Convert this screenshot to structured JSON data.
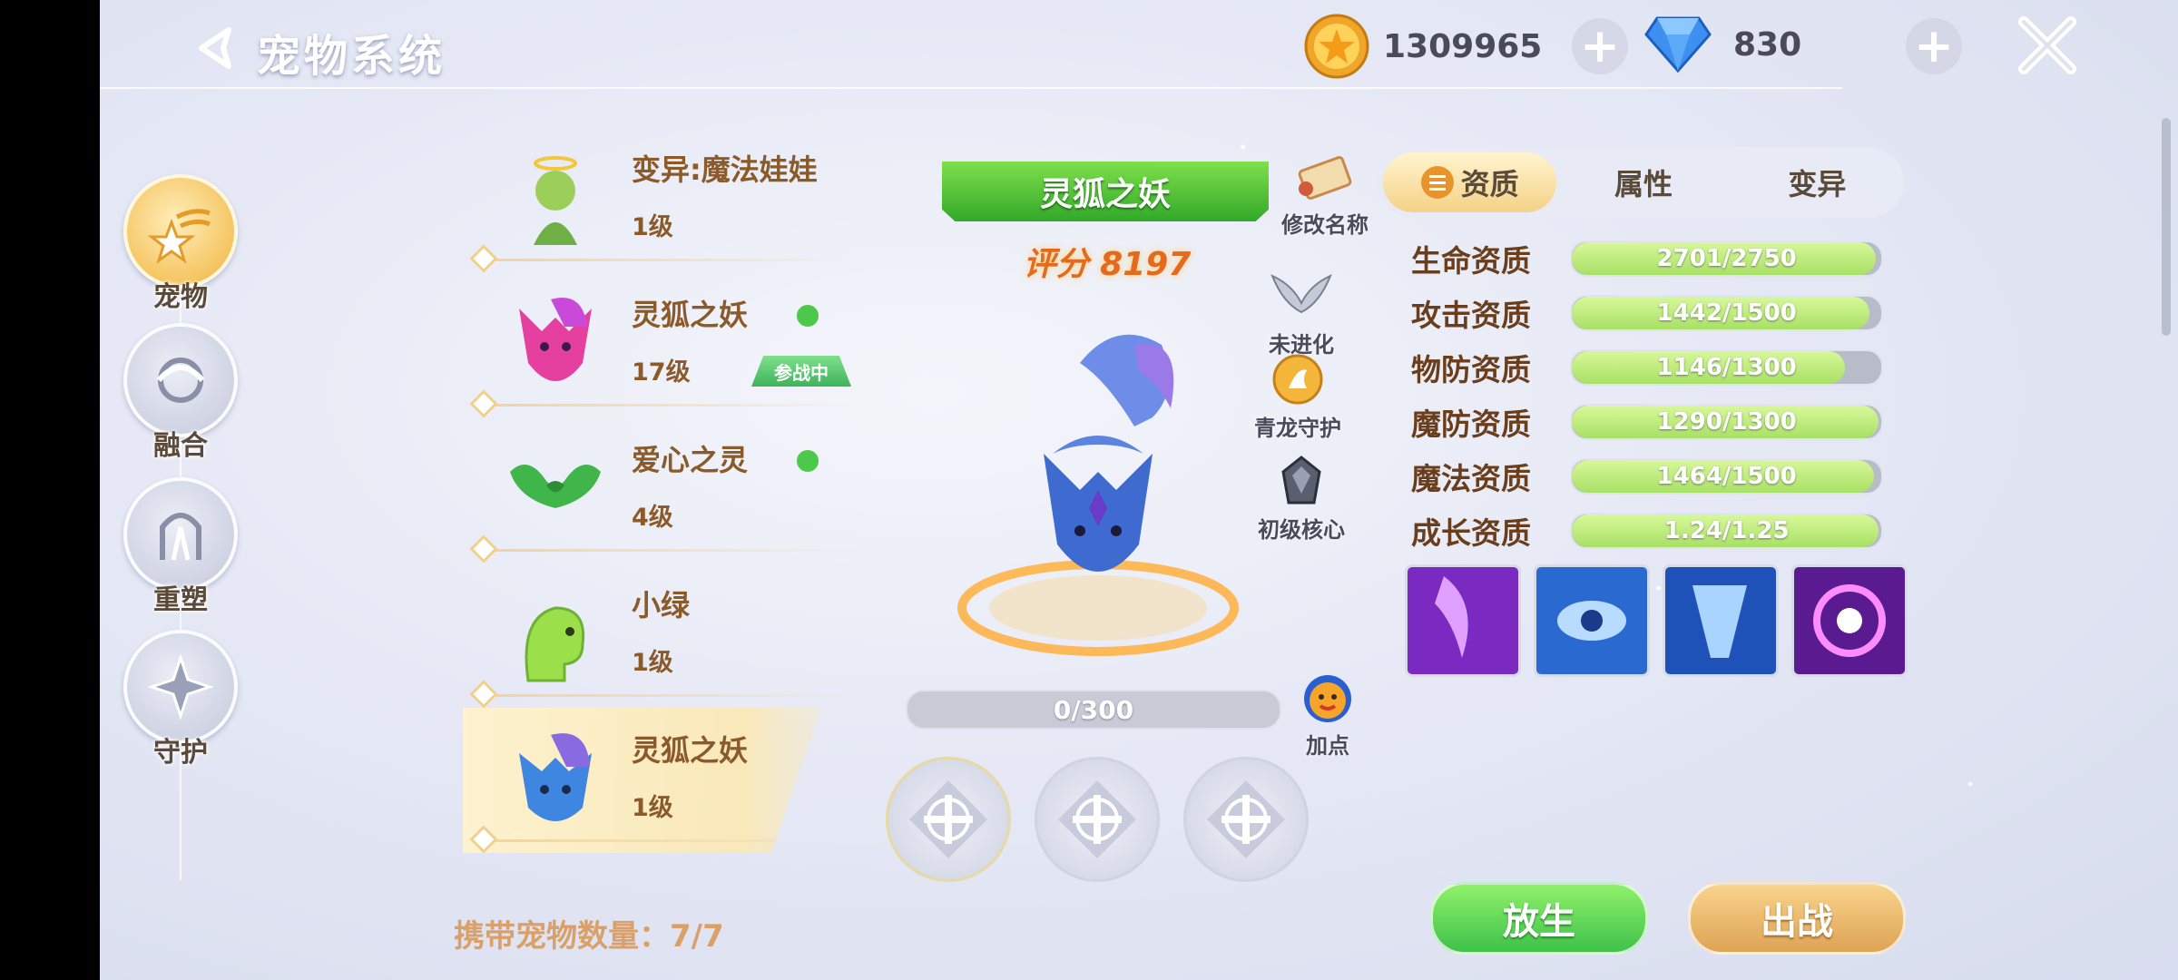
{
  "header": {
    "title": "宠物系统",
    "gold_value": "1309965",
    "gem_value": "830",
    "icons": [
      "back-arrow-icon",
      "gold-coin-icon",
      "diamond-icon",
      "plus-icon",
      "close-icon"
    ]
  },
  "nav": {
    "items": [
      {
        "label": "宠物",
        "icon": "pet-stars-icon",
        "active": true
      },
      {
        "label": "融合",
        "icon": "fusion-swirl-icon",
        "active": false
      },
      {
        "label": "重塑",
        "icon": "reshape-arch-icon",
        "active": false
      },
      {
        "label": "守护",
        "icon": "guard-star-icon",
        "active": false
      }
    ]
  },
  "pets": [
    {
      "name": "变异:魔法娃娃",
      "level": "1级",
      "online": false,
      "in_battle": false,
      "selected": false
    },
    {
      "name": "灵狐之妖",
      "level": "17级",
      "online": true,
      "in_battle": true,
      "selected": false
    },
    {
      "name": "爱心之灵",
      "level": "4级",
      "online": true,
      "in_battle": false,
      "selected": false
    },
    {
      "name": "小绿",
      "level": "1级",
      "online": false,
      "in_battle": false,
      "selected": false
    },
    {
      "name": "灵狐之妖",
      "level": "1级",
      "online": false,
      "in_battle": false,
      "selected": true
    }
  ],
  "in_battle_label": "参战中",
  "pet_count_label": "携带宠物数量：7/7",
  "detail": {
    "pet_name": "灵狐之妖",
    "rename_label": "修改名称",
    "score_label": "评分 8197",
    "evolve_label": "未进化",
    "guard_label": "青龙守护",
    "core_label": "初级核心",
    "exp_text": "0/300",
    "exp_fraction": 0,
    "addpoint_label": "加点"
  },
  "tabs": [
    {
      "label": "资质",
      "active": true
    },
    {
      "label": "属性",
      "active": false
    },
    {
      "label": "变异",
      "active": false
    }
  ],
  "attributes": [
    {
      "label": "生命资质",
      "value": "2701/2750",
      "fraction": 0.982
    },
    {
      "label": "攻击资质",
      "value": "1442/1500",
      "fraction": 0.961
    },
    {
      "label": "物防资质",
      "value": "1146/1300",
      "fraction": 0.882
    },
    {
      "label": "魔防资质",
      "value": "1290/1300",
      "fraction": 0.992
    },
    {
      "label": "魔法资质",
      "value": "1464/1500",
      "fraction": 0.976
    },
    {
      "label": "成长资质",
      "value": "1.24/1.25",
      "fraction": 0.992
    }
  ],
  "skills": [
    "purple-claw-skill-icon",
    "eye-wing-skill-icon",
    "blue-strike-skill-icon",
    "purple-vortex-skill-icon"
  ],
  "buttons": {
    "release": "放生",
    "deploy": "出战"
  },
  "colors": {
    "green": "#4cc84a",
    "gold": "#dfa354",
    "text_brown": "#6a3e1c",
    "bar_fill": "#a8e066"
  }
}
